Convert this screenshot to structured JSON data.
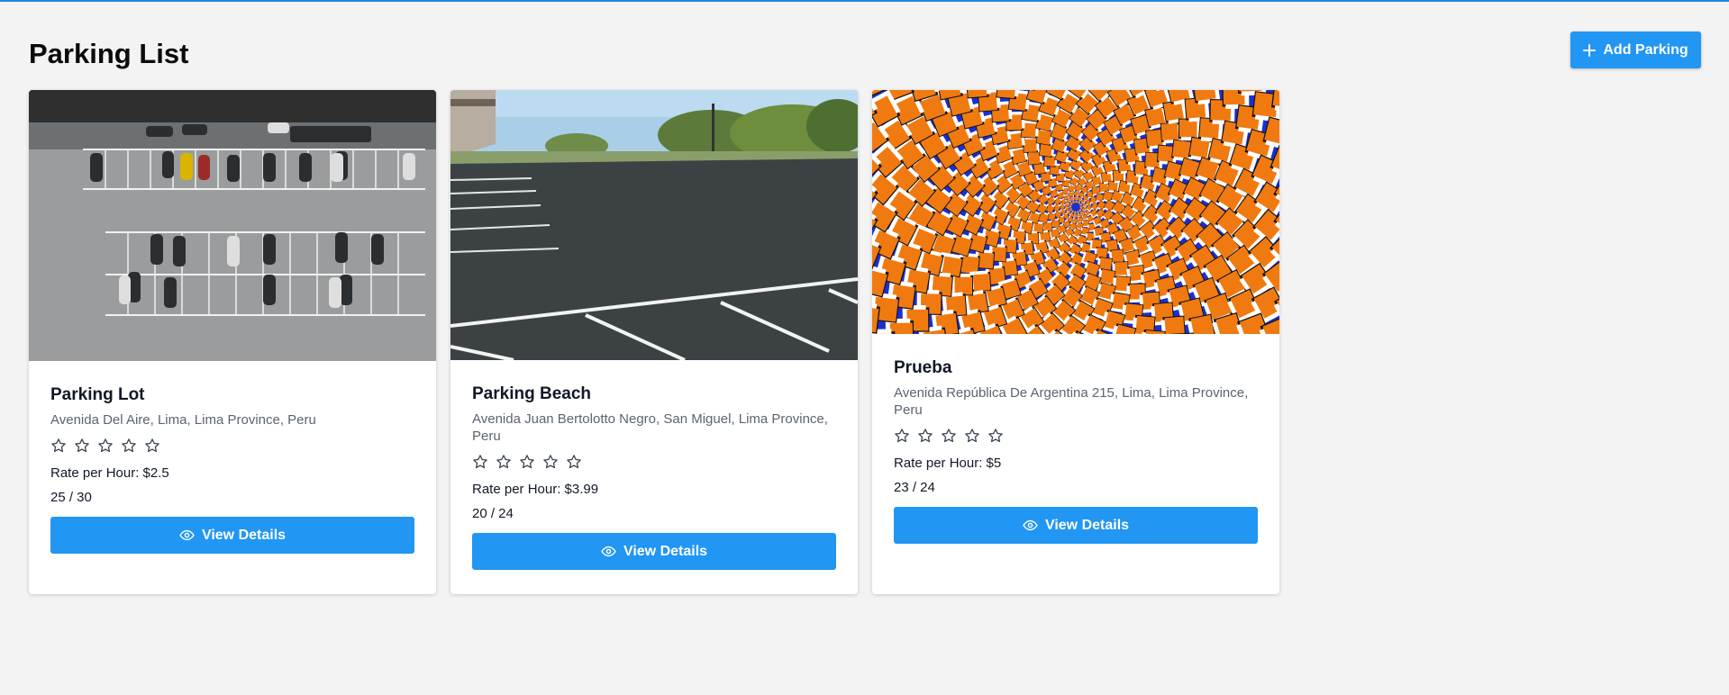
{
  "header": {
    "title": "Parking List",
    "add_button_label": "Add Parking"
  },
  "cards": [
    {
      "name": "Parking Lot",
      "address": "Avenida Del Aire, Lima, Lima Province, Peru",
      "rating": 0,
      "rate": "Rate per Hour: $2.5",
      "slots": "25 / 30",
      "button": "View Details",
      "image": "aerial-parking-lot-photo"
    },
    {
      "name": "Parking Beach",
      "address": "Avenida Juan Bertolotto Negro, San Miguel, Lima Province, Peru",
      "rating": 0,
      "rate": "Rate per Hour: $3.99",
      "slots": "20 / 24",
      "button": "View Details",
      "image": "empty-parking-lot-photo"
    },
    {
      "name": "Prueba",
      "address": "Avenida República De Argentina 215, Lima, Lima Province, Peru",
      "rating": 0,
      "rate": "Rate per Hour: $5",
      "slots": "23 / 24",
      "button": "View Details",
      "image": "optical-illusion-spiral-image"
    }
  ],
  "colors": {
    "accent": "#2196f3",
    "background": "#f3f3f3",
    "card": "#ffffff",
    "muted_text": "#5b6472"
  }
}
